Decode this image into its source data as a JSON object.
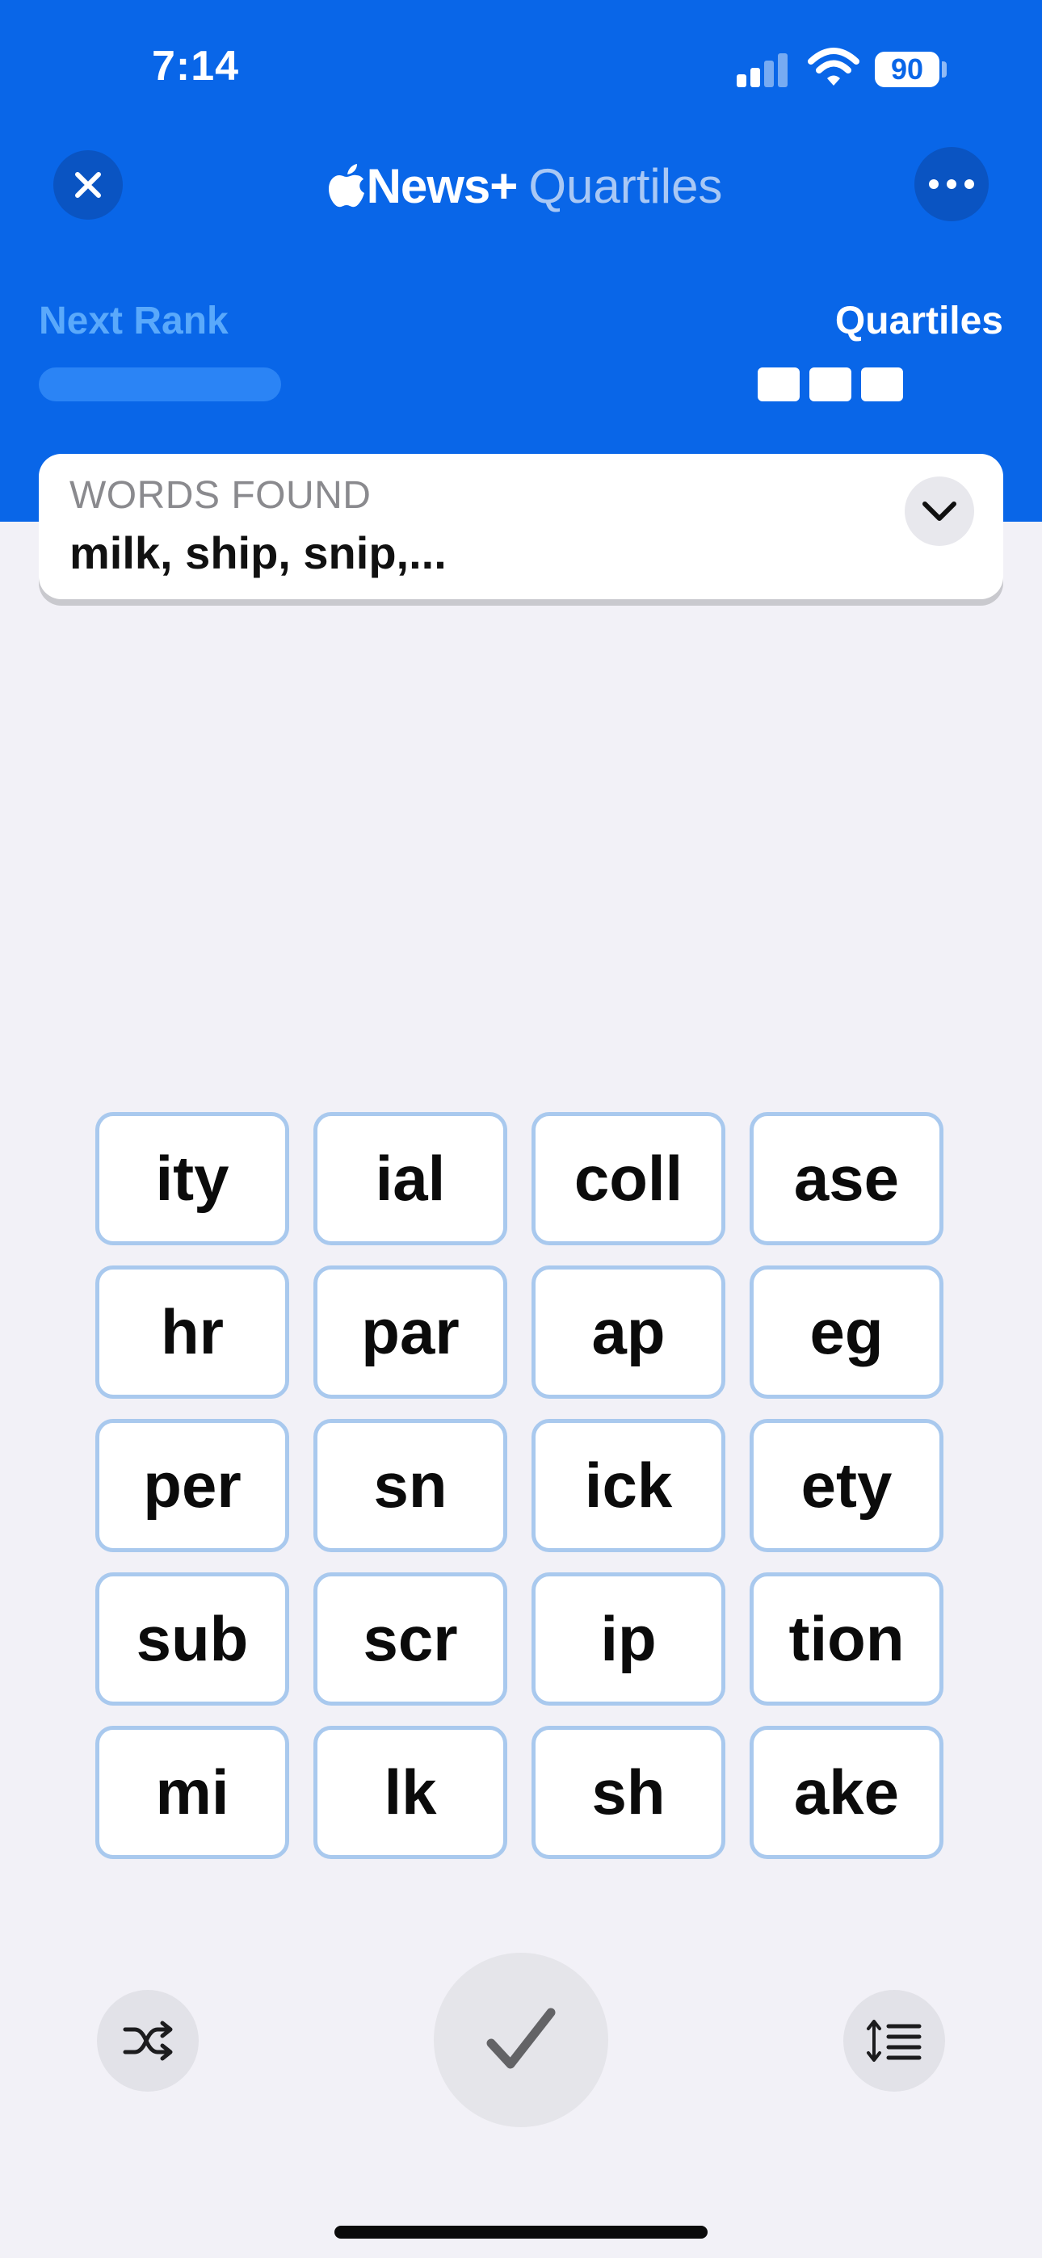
{
  "status_bar": {
    "time": "7:14",
    "battery_level": "90",
    "signal_bars": 2,
    "icons": [
      "cellular-signal-icon",
      "wifi-icon",
      "battery-icon"
    ]
  },
  "header": {
    "close_icon": "close-icon",
    "brand": "News+",
    "brand_icon": "apple-logo-icon",
    "game_title": "Quartiles",
    "more_icon": "more-icon",
    "background_color": "#0966e8"
  },
  "progress": {
    "next_rank_label": "Next Rank",
    "next_rank_fraction": 0,
    "quartiles_label": "Quartiles",
    "quartiles_found": 0,
    "quartiles_total": 3
  },
  "words_found": {
    "label": "WORDS FOUND",
    "list": "milk, ship, snip,...",
    "expand_icon": "chevron-down-icon"
  },
  "tiles": [
    "ity",
    "ial",
    "coll",
    "ase",
    "hr",
    "par",
    "ap",
    "eg",
    "per",
    "sn",
    "ick",
    "ety",
    "sub",
    "scr",
    "ip",
    "tion",
    "mi",
    "lk",
    "sh",
    "ake"
  ],
  "controls": {
    "shuffle_icon": "shuffle-icon",
    "submit_icon": "checkmark-icon",
    "sort_icon": "sort-list-icon"
  }
}
